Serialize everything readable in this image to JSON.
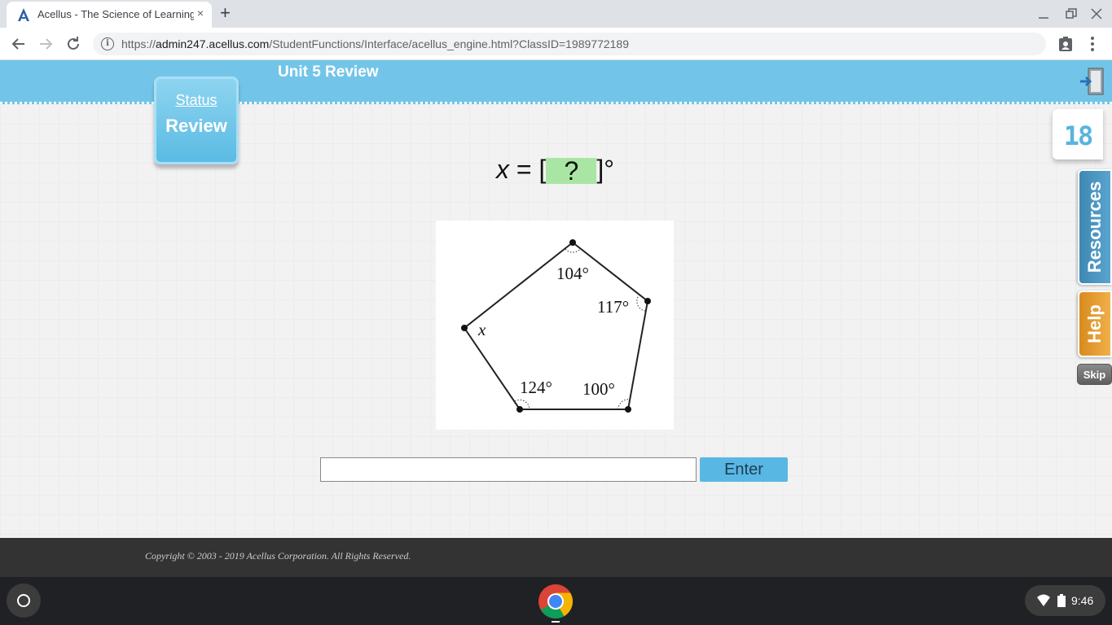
{
  "browser": {
    "tab_title": "Acellus - The Science of Learning",
    "tab_close": "×",
    "new_tab": "+",
    "url_prefix": "https://",
    "url_host": "admin247.acellus.com",
    "url_path": "/StudentFunctions/Interface/acellus_engine.html?ClassID=1989772189"
  },
  "header": {
    "unit_title": "Unit 5 Review"
  },
  "status_card": {
    "status_label": "Status",
    "mode_label": "Review"
  },
  "question": {
    "variable": "x",
    "equals": " = [",
    "placeholder": "?",
    "suffix": "]°"
  },
  "figure": {
    "angles": [
      "104°",
      "117°",
      "100°",
      "124°"
    ],
    "unknown_label": "x"
  },
  "counter": {
    "value": "18"
  },
  "side": {
    "resources_label": "Resources",
    "help_label": "Help",
    "skip_label": "Skip"
  },
  "answer": {
    "input_value": "",
    "enter_label": "Enter"
  },
  "footer": {
    "copyright": "Copyright © 2003 - 2019 Acellus Corporation.  All Rights Reserved."
  },
  "shelf": {
    "clock": "9:46"
  },
  "colors": {
    "header_blue": "#72c5e8",
    "enter_blue": "#59b7e4",
    "answer_green": "#a9e6a4",
    "resources_blue": "#3e88b4",
    "help_orange": "#d98a1e"
  }
}
